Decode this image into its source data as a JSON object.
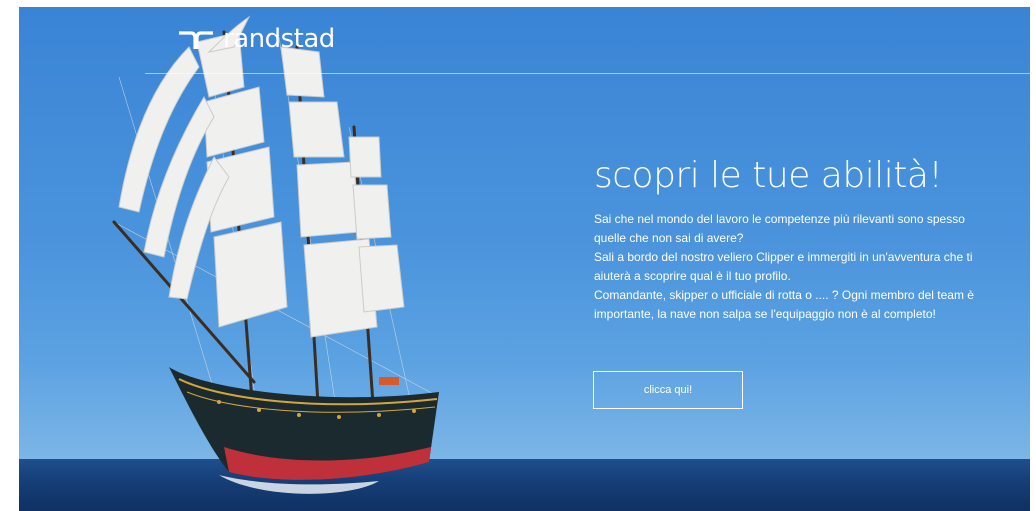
{
  "brand": {
    "logo_text": "randstad",
    "logo_icon": "randstad-logo-icon"
  },
  "hero": {
    "title": "scopri le tue abilità!",
    "paragraphs": [
      "Sai che nel mondo del lavoro le competenze più rilevanti sono spesso quelle che non sai di avere?",
      "Sali a bordo del nostro veliero Clipper e immergiti in un'avventura che ti aiuterà a scoprire qual è il tuo profilo.",
      "Comandante, skipper o ufficiale di rotta o .... ? Ogni membro del team è importante, la nave non salpa se l'equipaggio non è al completo!"
    ],
    "cta_label": "clicca qui!"
  },
  "colors": {
    "sky": "#4a93dc",
    "sea": "#163f78",
    "text": "#ffffff",
    "hull": "#1a2a2e",
    "hull_stripe": "#c0303a",
    "sail": "#f2f2ef"
  }
}
